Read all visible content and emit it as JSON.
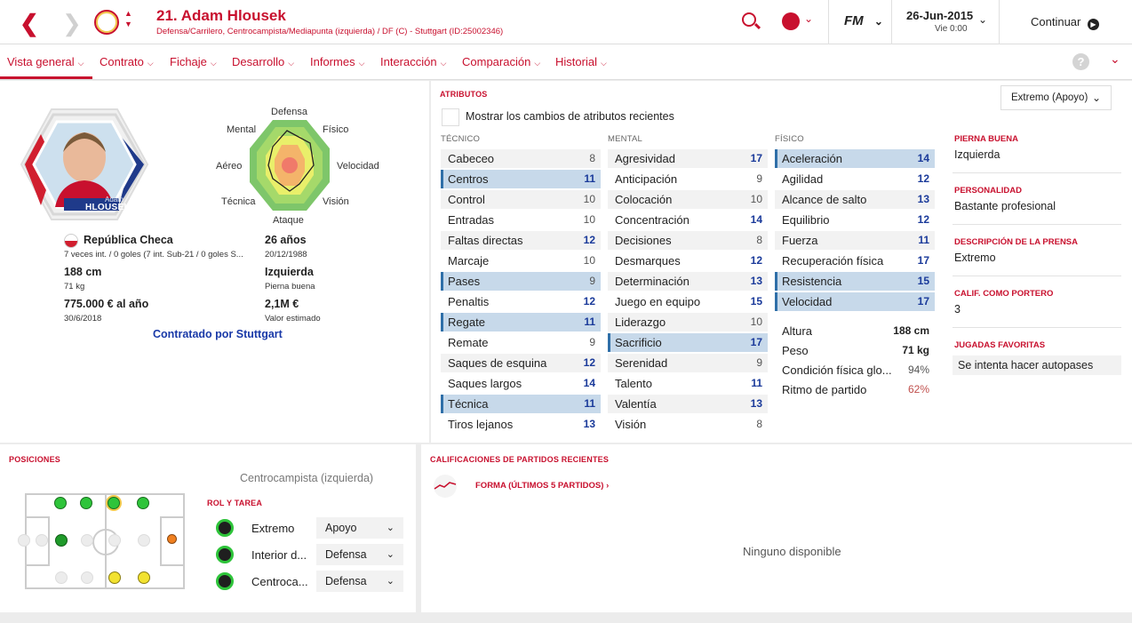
{
  "header": {
    "player_title": "21. Adam Hlousek",
    "player_subtitle": "Defensa/Carrilero, Centrocampista/Mediapunta (izquierda) / DF (C) - Stuttgart (ID:25002346)",
    "fm_label": "FM",
    "date": "26-Jun-2015",
    "day_time": "Vie 0:00",
    "continue_label": "Continuar"
  },
  "tabs": [
    {
      "label": "Vista general"
    },
    {
      "label": "Contrato"
    },
    {
      "label": "Fichaje"
    },
    {
      "label": "Desarrollo"
    },
    {
      "label": "Informes"
    },
    {
      "label": "Interacción"
    },
    {
      "label": "Comparación"
    },
    {
      "label": "Historial"
    }
  ],
  "profile": {
    "card_first": "Adam",
    "card_last": "HLOUSEK",
    "radar_labels": {
      "top": "Defensa",
      "top_right": "Físico",
      "right": "Velocidad",
      "bottom_right": "Visión",
      "bottom": "Ataque",
      "bottom_left": "Técnica",
      "left": "Aéreo",
      "top_left": "Mental"
    },
    "nationality": "República Checa",
    "caps": "7 veces int. / 0 goles (7 int. Sub-21 / 0 goles S...",
    "age": "26 años",
    "dob": "20/12/1988",
    "height": "188 cm",
    "weight": "71 kg",
    "foot": "Izquierda",
    "foot_label": "Pierna buena",
    "wage": "775.000 € al año",
    "contract_end": "30/6/2018",
    "value": "2,1M €",
    "value_label": "Valor estimado",
    "contracted_by": "Contratado por Stuttgart"
  },
  "attributes": {
    "title": "ATRIBUTOS",
    "role_select": "Extremo (Apoyo)",
    "show_changes_label": "Mostrar los cambios de atributos recientes",
    "technical_header": "TÉCNICO",
    "mental_header": "MENTAL",
    "physical_header": "FÍSICO",
    "technical": [
      {
        "name": "Cabeceo",
        "value": "8"
      },
      {
        "name": "Centros",
        "value": "11"
      },
      {
        "name": "Control",
        "value": "10"
      },
      {
        "name": "Entradas",
        "value": "10"
      },
      {
        "name": "Faltas directas",
        "value": "12"
      },
      {
        "name": "Marcaje",
        "value": "10"
      },
      {
        "name": "Pases",
        "value": "9"
      },
      {
        "name": "Penaltis",
        "value": "12"
      },
      {
        "name": "Regate",
        "value": "11"
      },
      {
        "name": "Remate",
        "value": "9"
      },
      {
        "name": "Saques de esquina",
        "value": "12"
      },
      {
        "name": "Saques largos",
        "value": "14"
      },
      {
        "name": "Técnica",
        "value": "11"
      },
      {
        "name": "Tiros lejanos",
        "value": "13"
      }
    ],
    "mental": [
      {
        "name": "Agresividad",
        "value": "17"
      },
      {
        "name": "Anticipación",
        "value": "9"
      },
      {
        "name": "Colocación",
        "value": "10"
      },
      {
        "name": "Concentración",
        "value": "14"
      },
      {
        "name": "Decisiones",
        "value": "8"
      },
      {
        "name": "Desmarques",
        "value": "12"
      },
      {
        "name": "Determinación",
        "value": "13"
      },
      {
        "name": "Juego en equipo",
        "value": "15"
      },
      {
        "name": "Liderazgo",
        "value": "10"
      },
      {
        "name": "Sacrificio",
        "value": "17"
      },
      {
        "name": "Serenidad",
        "value": "9"
      },
      {
        "name": "Talento",
        "value": "11"
      },
      {
        "name": "Valentía",
        "value": "13"
      },
      {
        "name": "Visión",
        "value": "8"
      }
    ],
    "physical": [
      {
        "name": "Aceleración",
        "value": "14"
      },
      {
        "name": "Agilidad",
        "value": "12"
      },
      {
        "name": "Alcance de salto",
        "value": "13"
      },
      {
        "name": "Equilibrio",
        "value": "12"
      },
      {
        "name": "Fuerza",
        "value": "11"
      },
      {
        "name": "Recuperación física",
        "value": "17"
      },
      {
        "name": "Resistencia",
        "value": "15"
      },
      {
        "name": "Velocidad",
        "value": "17"
      }
    ],
    "extra": [
      {
        "name": "Altura",
        "value": "188 cm"
      },
      {
        "name": "Peso",
        "value": "71 kg"
      },
      {
        "name": "Condición física glo...",
        "value": "94%"
      },
      {
        "name": "Ritmo de partido",
        "value": "62%"
      }
    ]
  },
  "side": {
    "foot_label": "PIERNA BUENA",
    "foot_value": "Izquierda",
    "personality_label": "PERSONALIDAD",
    "personality_value": "Bastante profesional",
    "press_label": "DESCRIPCIÓN DE LA PRENSA",
    "press_value": "Extremo",
    "gk_label": "CALIF. COMO PORTERO",
    "gk_value": "3",
    "moves_label": "JUGADAS FAVORITAS",
    "moves_value": "Se intenta hacer autopases"
  },
  "positions": {
    "title": "POSICIONES",
    "selected": "Centrocampista (izquierda)",
    "role_header": "ROL Y TAREA",
    "roles": [
      {
        "role": "Extremo",
        "duty": "Apoyo"
      },
      {
        "role": "Interior d...",
        "duty": "Defensa"
      },
      {
        "role": "Centroca...",
        "duty": "Defensa"
      }
    ]
  },
  "ratings": {
    "title": "CALIFICACIONES DE PARTIDOS RECIENTES",
    "form_label": "FORMA (ÚLTIMOS 5 PARTIDOS)",
    "empty": "Ninguno disponible"
  },
  "colors": {
    "accent": "#c8102e",
    "highlight": "#c7d9ea",
    "blue_value": "#1a3a9a"
  }
}
